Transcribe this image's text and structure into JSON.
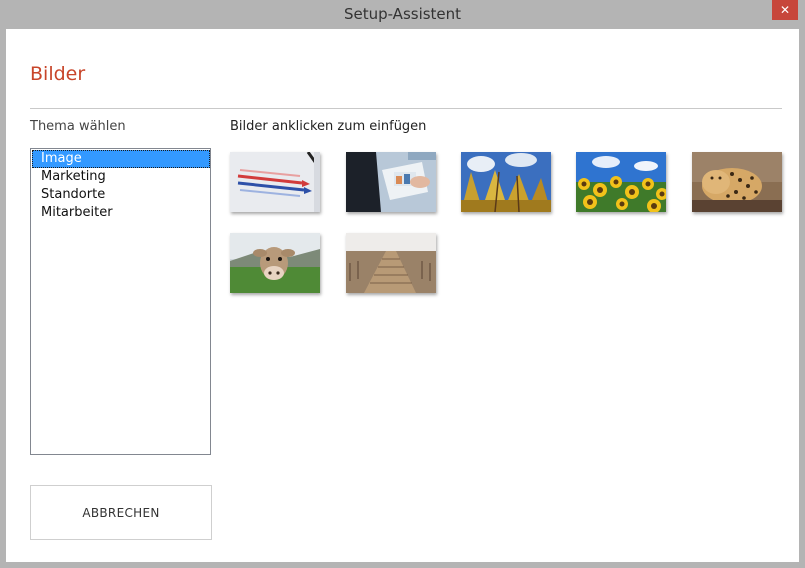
{
  "window": {
    "title": "Setup-Assistent",
    "close_glyph": "✕"
  },
  "page": {
    "heading": "Bilder"
  },
  "theme": {
    "label": "Thema wählen",
    "items": [
      "Image",
      "Marketing",
      "Standorte",
      "Mitarbeiter"
    ],
    "selected": "Image"
  },
  "images": {
    "label": "Bilder anklicken zum einfügen",
    "thumbnails": [
      {
        "name": "chart-arrows-image"
      },
      {
        "name": "business-tablet-image"
      },
      {
        "name": "autumn-trees-sky-image"
      },
      {
        "name": "sunflowers-field-image"
      },
      {
        "name": "leopard-image"
      },
      {
        "name": "cow-meadow-image"
      },
      {
        "name": "wooden-boardwalk-image"
      }
    ]
  },
  "buttons": {
    "cancel_label": "ABBRECHEN"
  },
  "colors": {
    "accent": "#c8452a",
    "selection": "#3399ff",
    "close": "#c7463b"
  }
}
